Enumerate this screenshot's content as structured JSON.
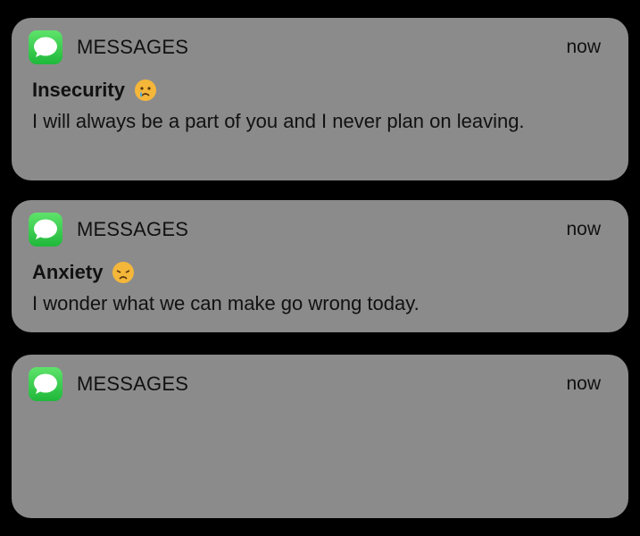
{
  "notifications": [
    {
      "app": "MESSAGES",
      "time": "now",
      "title": "Insecurity",
      "emoji": "crying-face-icon",
      "body": "I will always be a part of you and I never plan on leaving."
    },
    {
      "app": "MESSAGES",
      "time": "now",
      "title": "Anxiety",
      "emoji": "disappointed-face-icon",
      "body": "I wonder what we can make go wrong today."
    },
    {
      "app": "MESSAGES",
      "time": "now"
    }
  ],
  "colors": {
    "card": "#8b8b8b",
    "background": "#000000",
    "app_icon": "#34c84a"
  }
}
